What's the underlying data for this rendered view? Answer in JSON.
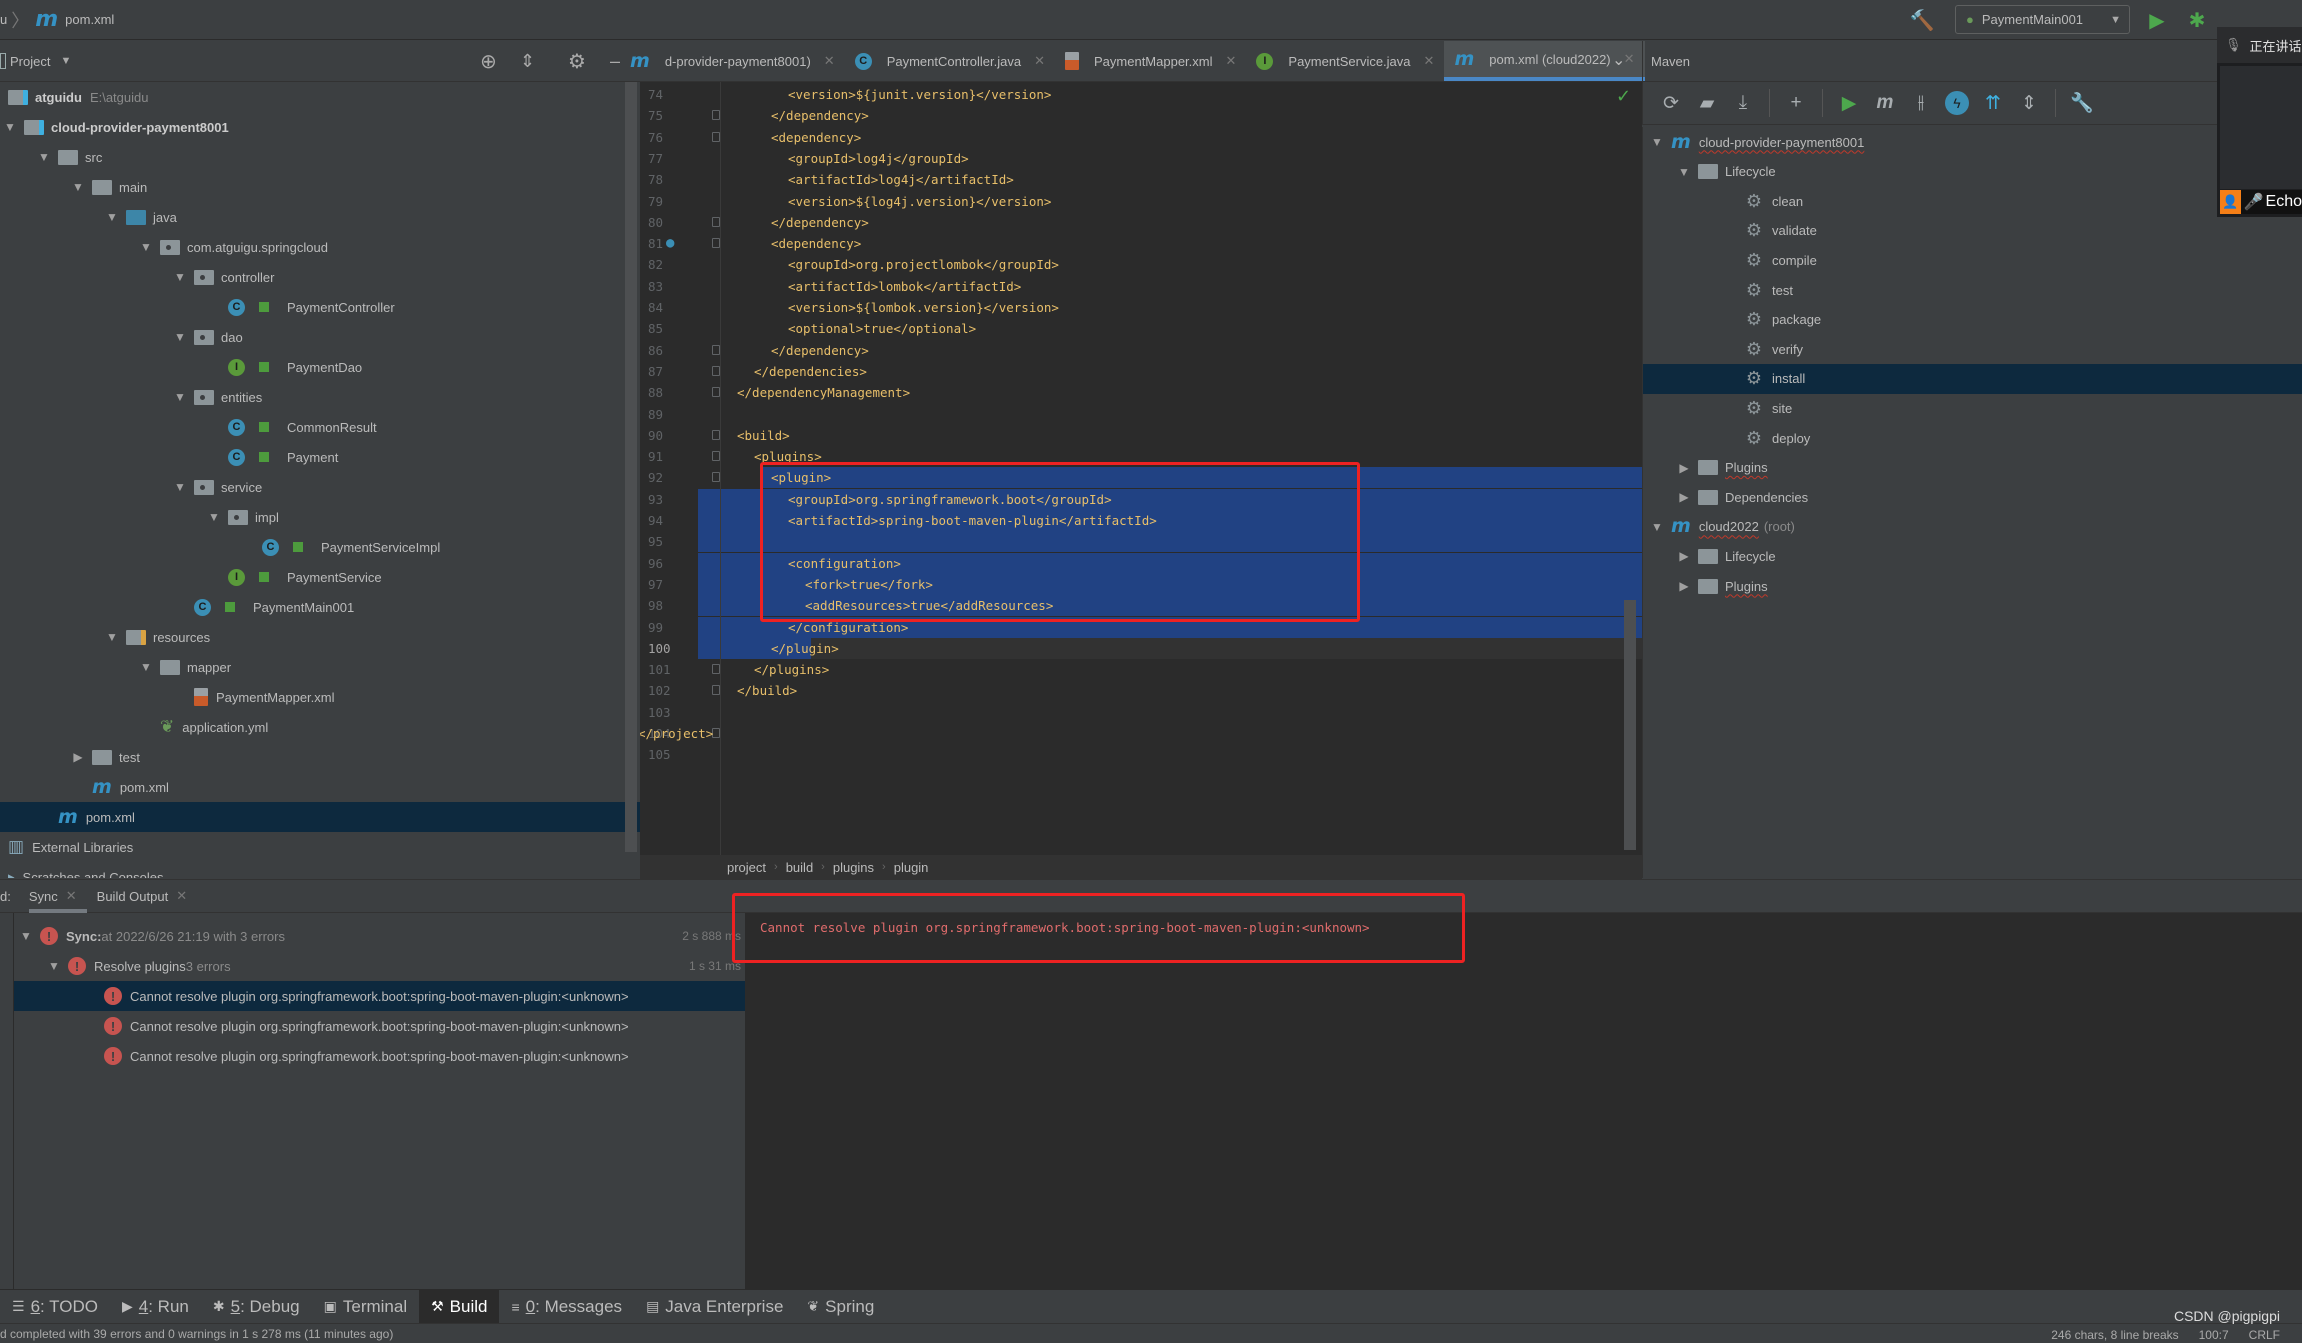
{
  "navbar": {
    "crumb_prefix": "u",
    "file": "pom.xml",
    "run_config": "PaymentMain001"
  },
  "project_panel": {
    "title": "Project",
    "tree": [
      {
        "label": "atguidu",
        "hint": "E:\\atguidu",
        "depth": 0,
        "icon": "module-folder",
        "arrow": "",
        "bold": true
      },
      {
        "label": "cloud-provider-payment8001",
        "depth": 0,
        "icon": "module-folder",
        "arrow": "down",
        "bold": true
      },
      {
        "label": "src",
        "depth": 1,
        "icon": "folder",
        "arrow": "down"
      },
      {
        "label": "main",
        "depth": 2,
        "icon": "folder",
        "arrow": "down"
      },
      {
        "label": "java",
        "depth": 3,
        "icon": "source-folder",
        "arrow": "down"
      },
      {
        "label": "com.atguigu.springcloud",
        "depth": 4,
        "icon": "package",
        "arrow": "down"
      },
      {
        "label": "controller",
        "depth": 5,
        "icon": "package",
        "arrow": "down"
      },
      {
        "label": "PaymentController",
        "depth": 6,
        "icon": "class",
        "arrow": ""
      },
      {
        "label": "dao",
        "depth": 5,
        "icon": "package",
        "arrow": "down"
      },
      {
        "label": "PaymentDao",
        "depth": 6,
        "icon": "interface",
        "arrow": ""
      },
      {
        "label": "entities",
        "depth": 5,
        "icon": "package",
        "arrow": "down"
      },
      {
        "label": "CommonResult",
        "depth": 6,
        "icon": "class",
        "arrow": ""
      },
      {
        "label": "Payment",
        "depth": 6,
        "icon": "class",
        "arrow": ""
      },
      {
        "label": "service",
        "depth": 5,
        "icon": "package",
        "arrow": "down"
      },
      {
        "label": "impl",
        "depth": 6,
        "icon": "package",
        "arrow": "down"
      },
      {
        "label": "PaymentServiceImpl",
        "depth": 7,
        "icon": "class",
        "arrow": ""
      },
      {
        "label": "PaymentService",
        "depth": 6,
        "icon": "interface",
        "arrow": ""
      },
      {
        "label": "PaymentMain001",
        "depth": 5,
        "icon": "spring-boot-class",
        "arrow": ""
      },
      {
        "label": "resources",
        "depth": 3,
        "icon": "resources-folder",
        "arrow": "down"
      },
      {
        "label": "mapper",
        "depth": 4,
        "icon": "folder",
        "arrow": "down"
      },
      {
        "label": "PaymentMapper.xml",
        "depth": 5,
        "icon": "xml-file",
        "arrow": ""
      },
      {
        "label": "application.yml",
        "depth": 4,
        "icon": "spring-yml",
        "arrow": ""
      },
      {
        "label": "test",
        "depth": 2,
        "icon": "folder",
        "arrow": "right"
      },
      {
        "label": "pom.xml",
        "depth": 2,
        "icon": "maven",
        "arrow": ""
      },
      {
        "label": "pom.xml",
        "depth": 1,
        "icon": "maven",
        "arrow": "",
        "selected": true
      },
      {
        "label": "External Libraries",
        "depth": 0,
        "icon": "libraries",
        "arrow": ""
      },
      {
        "label": "Scratches and Consoles",
        "depth": 0,
        "icon": "console",
        "arrow": ""
      }
    ]
  },
  "editor": {
    "tabs": [
      {
        "label": "d-provider-payment8001)",
        "icon": "maven",
        "active": false
      },
      {
        "label": "PaymentController.java",
        "icon": "class",
        "active": false
      },
      {
        "label": "PaymentMapper.xml",
        "icon": "xml-file",
        "active": false
      },
      {
        "label": "PaymentService.java",
        "icon": "interface",
        "active": false
      },
      {
        "label": "pom.xml (cloud2022)",
        "icon": "maven",
        "active": true
      }
    ],
    "lines": [
      {
        "n": "74",
        "indent": 3,
        "text": "<version>${junit.version}</version>"
      },
      {
        "n": "75",
        "indent": 2,
        "text": "</dependency>",
        "fold": true
      },
      {
        "n": "76",
        "indent": 2,
        "text": "<dependency>",
        "fold": true
      },
      {
        "n": "77",
        "indent": 3,
        "text": "<groupId>log4j</groupId>"
      },
      {
        "n": "78",
        "indent": 3,
        "text": "<artifactId>log4j</artifactId>"
      },
      {
        "n": "79",
        "indent": 3,
        "text": "<version>${log4j.version}</version>"
      },
      {
        "n": "80",
        "indent": 2,
        "text": "</dependency>",
        "fold": true
      },
      {
        "n": "81",
        "indent": 2,
        "text": "<dependency>",
        "fold": true,
        "marker": true
      },
      {
        "n": "82",
        "indent": 3,
        "text": "<groupId>org.projectlombok</groupId>"
      },
      {
        "n": "83",
        "indent": 3,
        "text": "<artifactId>lombok</artifactId>"
      },
      {
        "n": "84",
        "indent": 3,
        "text": "<version>${lombok.version}</version>"
      },
      {
        "n": "85",
        "indent": 3,
        "text": "<optional>true</optional>"
      },
      {
        "n": "86",
        "indent": 2,
        "text": "</dependency>",
        "fold": true
      },
      {
        "n": "87",
        "indent": 1,
        "text": "</dependencies>",
        "fold": true
      },
      {
        "n": "88",
        "indent": 0,
        "text": "</dependencyManagement>",
        "fold": true
      },
      {
        "n": "89",
        "indent": 0,
        "text": ""
      },
      {
        "n": "90",
        "indent": 0,
        "text": "<build>",
        "fold": true
      },
      {
        "n": "91",
        "indent": 1,
        "text": "<plugins>",
        "fold": true
      },
      {
        "n": "92",
        "indent": 2,
        "text": "<plugin>",
        "fold": true,
        "sel": "partial"
      },
      {
        "n": "93",
        "indent": 3,
        "text": "<groupId>org.springframework.boot</groupId>",
        "sel": "full"
      },
      {
        "n": "94",
        "indent": 3,
        "text": "<artifactId>spring-boot-maven-plugin</artifactId>",
        "sel": "full"
      },
      {
        "n": "95",
        "indent": 0,
        "text": "",
        "sel": "full"
      },
      {
        "n": "96",
        "indent": 3,
        "text": "<configuration>",
        "fold": true,
        "sel": "full"
      },
      {
        "n": "97",
        "indent": 4,
        "text": "<fork>true</fork>",
        "sel": "full"
      },
      {
        "n": "98",
        "indent": 4,
        "text": "<addResources>true</addResources>",
        "sel": "full"
      },
      {
        "n": "99",
        "indent": 3,
        "text": "</configuration>",
        "fold": true,
        "sel": "full"
      },
      {
        "n": "100",
        "indent": 2,
        "text": "</plugin>",
        "fold": true,
        "sel": "caret",
        "current": true
      },
      {
        "n": "101",
        "indent": 1,
        "text": "</plugins>",
        "fold": true
      },
      {
        "n": "102",
        "indent": 0,
        "text": "</build>",
        "fold": true
      },
      {
        "n": "103",
        "indent": 0,
        "text": ""
      },
      {
        "n": "104",
        "indent": -1,
        "text": "</project>",
        "fold": true
      },
      {
        "n": "105",
        "indent": 0,
        "text": ""
      }
    ],
    "breadcrumb": [
      "project",
      "build",
      "plugins",
      "plugin"
    ]
  },
  "maven": {
    "title": "Maven",
    "toolbar": [
      "reload-icon",
      "reimport-folder-icon",
      "download-icon",
      "add-icon",
      "run-icon",
      "maven-goal-icon",
      "skip-tests-icon",
      "offline-icon",
      "show-dependencies-icon",
      "collapse-all-icon",
      "settings-wrench-icon"
    ],
    "tree": [
      {
        "label": "cloud-provider-payment8001",
        "depth": 0,
        "icon": "maven-project",
        "arrow": "down",
        "error": true
      },
      {
        "label": "Lifecycle",
        "depth": 1,
        "icon": "lifecycle-folder",
        "arrow": "down"
      },
      {
        "label": "clean",
        "depth": 2,
        "icon": "gear"
      },
      {
        "label": "validate",
        "depth": 2,
        "icon": "gear"
      },
      {
        "label": "compile",
        "depth": 2,
        "icon": "gear"
      },
      {
        "label": "test",
        "depth": 2,
        "icon": "gear"
      },
      {
        "label": "package",
        "depth": 2,
        "icon": "gear"
      },
      {
        "label": "verify",
        "depth": 2,
        "icon": "gear"
      },
      {
        "label": "install",
        "depth": 2,
        "icon": "gear",
        "selected": true
      },
      {
        "label": "site",
        "depth": 2,
        "icon": "gear"
      },
      {
        "label": "deploy",
        "depth": 2,
        "icon": "gear"
      },
      {
        "label": "Plugins",
        "depth": 1,
        "icon": "lifecycle-folder",
        "arrow": "right",
        "error": true
      },
      {
        "label": "Dependencies",
        "depth": 1,
        "icon": "dependencies-folder",
        "arrow": "right"
      },
      {
        "label": "cloud2022",
        "hint": "(root)",
        "depth": 0,
        "icon": "maven-project",
        "arrow": "down",
        "error": true
      },
      {
        "label": "Lifecycle",
        "depth": 1,
        "icon": "lifecycle-folder",
        "arrow": "right"
      },
      {
        "label": "Plugins",
        "depth": 1,
        "icon": "lifecycle-folder",
        "arrow": "right",
        "error": true
      }
    ]
  },
  "overlay": {
    "status": "正在讲话",
    "speaker": "Echo"
  },
  "build_panel": {
    "label": "d:",
    "tabs": [
      {
        "label": "Sync",
        "active": true
      },
      {
        "label": "Build Output",
        "active": false
      }
    ],
    "tree": [
      {
        "title": "Sync:",
        "text": " at 2022/6/26 21:19 with 3 errors",
        "duration": "2 s 888 ms",
        "depth": 0,
        "arrow": "down"
      },
      {
        "title": "Resolve plugins",
        "text": " 3 errors",
        "duration": "1 s 31 ms",
        "depth": 1,
        "arrow": "down"
      },
      {
        "title": "Cannot resolve plugin org.springframework.boot:spring-boot-maven-plugin:<unknown>",
        "text": "",
        "duration": "",
        "depth": 2,
        "selected": true
      },
      {
        "title": "Cannot resolve plugin org.springframework.boot:spring-boot-maven-plugin:<unknown>",
        "text": "",
        "duration": "",
        "depth": 2
      },
      {
        "title": "Cannot resolve plugin org.springframework.boot:spring-boot-maven-plugin:<unknown>",
        "text": "",
        "duration": "",
        "depth": 2
      }
    ],
    "console_message": "Cannot resolve plugin org.springframework.boot:spring-boot-maven-plugin:<unknown>"
  },
  "tool_windows": [
    {
      "key": "6",
      "label": ": TODO",
      "icon": "todo-icon"
    },
    {
      "key": "4",
      "label": ": Run",
      "icon": "run-icon"
    },
    {
      "key": "5",
      "label": ": Debug",
      "icon": "debug-icon"
    },
    {
      "key": "",
      "label": "Terminal",
      "icon": "terminal-icon"
    },
    {
      "key": "",
      "label": "Build",
      "icon": "build-hammer-icon",
      "active": true
    },
    {
      "key": "0",
      "label": ": Messages",
      "icon": "messages-icon"
    },
    {
      "key": "",
      "label": "Java Enterprise",
      "icon": "java-enterprise-icon"
    },
    {
      "key": "",
      "label": "Spring",
      "icon": "spring-leaf-icon"
    }
  ],
  "status_bar": {
    "message": "d completed with 39 errors and 0 warnings in 1 s 278 ms (11 minutes ago)",
    "chars": "246 chars, 8 line breaks",
    "position": "100:7",
    "line_sep": "CRLF",
    "watermark": "CSDN @pigpigpi"
  },
  "colors": {
    "accent": "#4a88c7",
    "selection": "#214283",
    "error": "#c75450",
    "annotation_box": "#ee2222"
  }
}
